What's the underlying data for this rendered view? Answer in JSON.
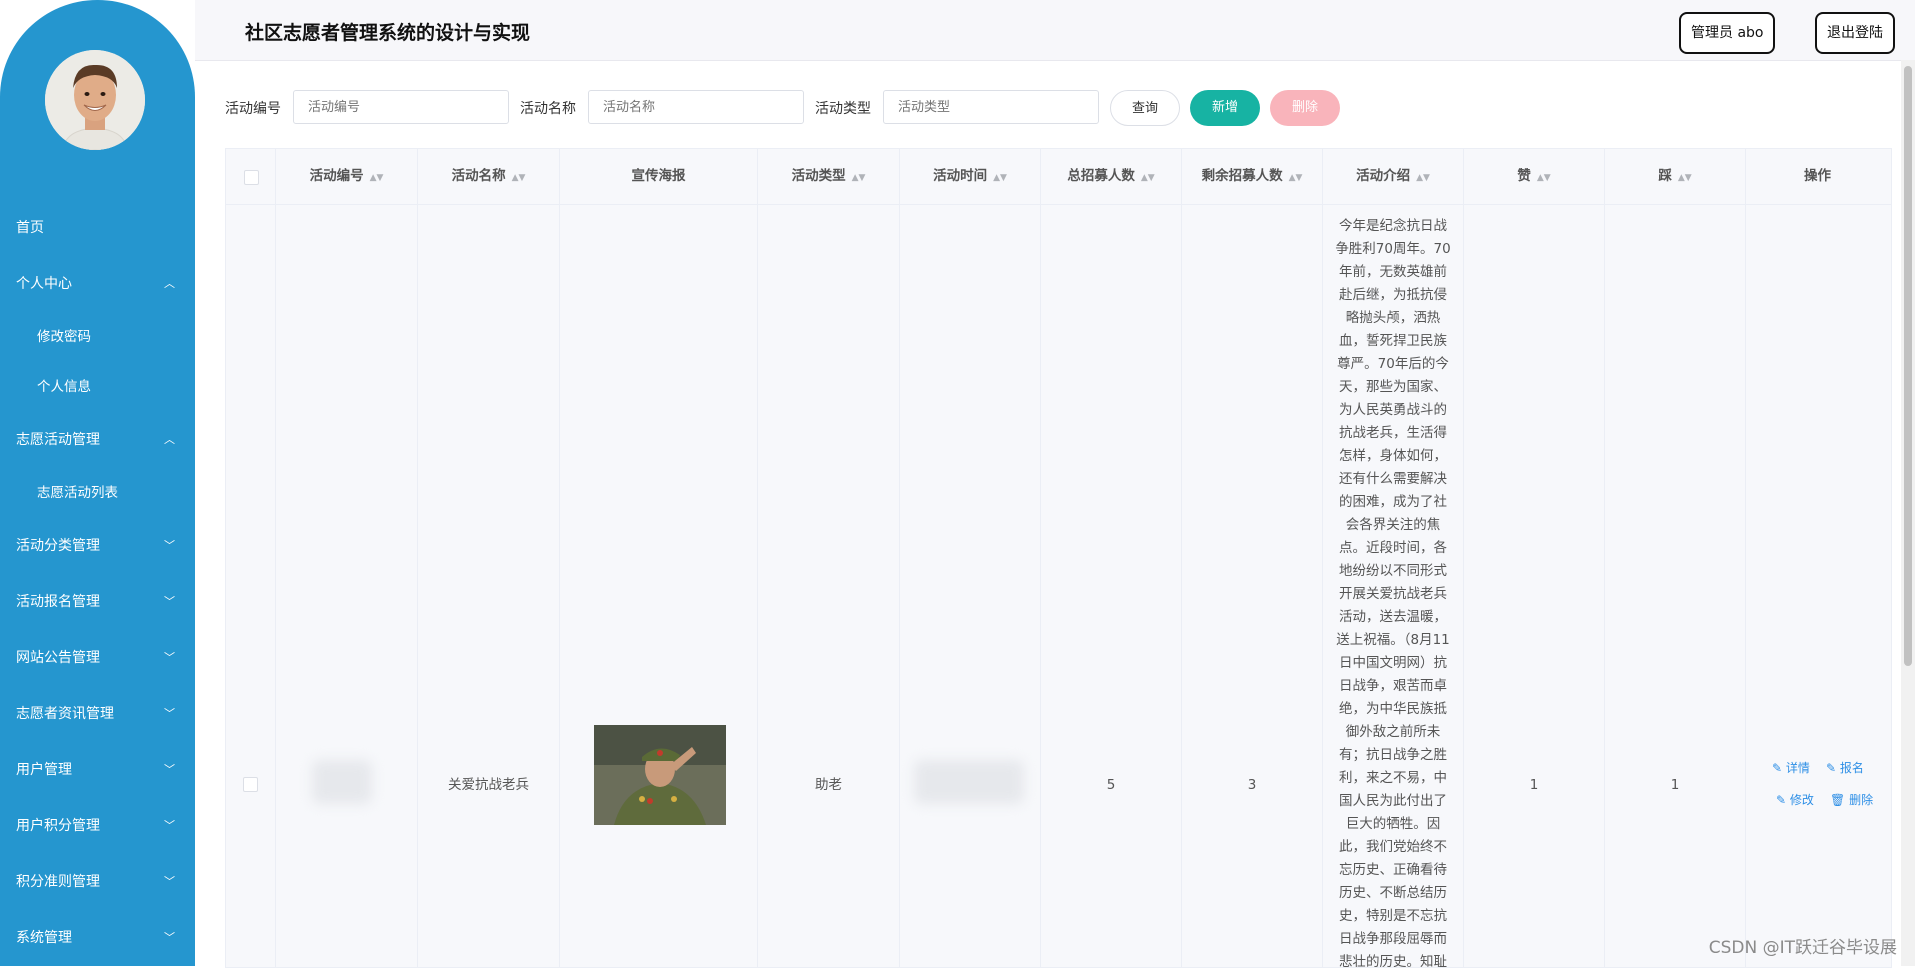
{
  "header": {
    "title": "社区志愿者管理系统的设计与实现",
    "admin_label": "管理员 abo",
    "logout_label": "退出登陆"
  },
  "sidebar": {
    "items": [
      {
        "label": "首页"
      },
      {
        "label": "个人中心",
        "expanded": true
      },
      {
        "label": "修改密码",
        "sub": true
      },
      {
        "label": "个人信息",
        "sub": true
      },
      {
        "label": "志愿活动管理",
        "expanded": true
      },
      {
        "label": "志愿活动列表",
        "sub": true
      },
      {
        "label": "活动分类管理",
        "expanded": false
      },
      {
        "label": "活动报名管理",
        "expanded": false
      },
      {
        "label": "网站公告管理",
        "expanded": false
      },
      {
        "label": "志愿者资讯管理",
        "expanded": false
      },
      {
        "label": "用户管理",
        "expanded": false
      },
      {
        "label": "用户积分管理",
        "expanded": false
      },
      {
        "label": "积分准则管理",
        "expanded": false
      },
      {
        "label": "系统管理",
        "expanded": false
      }
    ]
  },
  "search": {
    "code_label": "活动编号",
    "code_placeholder": "活动编号",
    "name_label": "活动名称",
    "name_placeholder": "活动名称",
    "type_label": "活动类型",
    "type_placeholder": "活动类型",
    "query_label": "查询",
    "add_label": "新增",
    "delete_label": "删除"
  },
  "table": {
    "columns": [
      "活动编号",
      "活动名称",
      "宣传海报",
      "活动类型",
      "活动时间",
      "总招募人数",
      "剩余招募人数",
      "活动介绍",
      "赞",
      "踩",
      "操作"
    ],
    "row": {
      "name": "关爱抗战老兵",
      "type": "助老",
      "total": "5",
      "remaining": "3",
      "intro": "今年是纪念抗日战争胜利70周年。70年前，无数英雄前赴后继，为抵抗侵略抛头颅，洒热血，誓死捍卫民族尊严。70年后的今天，那些为国家、为人民英勇战斗的抗战老兵，生活得怎样，身体如何，还有什么需要解决的困难，成为了社会各界关注的焦点。近段时间，各地纷纷以不同形式开展关爱抗战老兵活动，送去温暖，送上祝福。（8月11日中国文明网）抗日战争，艰苦而卓绝，为中华民族抵御外敌之前所未有；抗日战争之胜利，来之不易，中国人民为此付出了巨大的牺牲。因此，我们党始终不忘历史、正确看待历史、不断总结历史，特别是不忘抗日战争那段屈辱而悲壮的历史。知耻",
      "likes": "1",
      "dislikes": "1",
      "ops": [
        "详情",
        "报名",
        "修改",
        "删除"
      ]
    }
  },
  "watermark": "CSDN @IT跃迁谷毕设展",
  "colors": {
    "sidebar": "#2596cf",
    "add_button": "#17b3a3",
    "delete_button": "#f9b4bb",
    "link": "#2e8fe6"
  }
}
